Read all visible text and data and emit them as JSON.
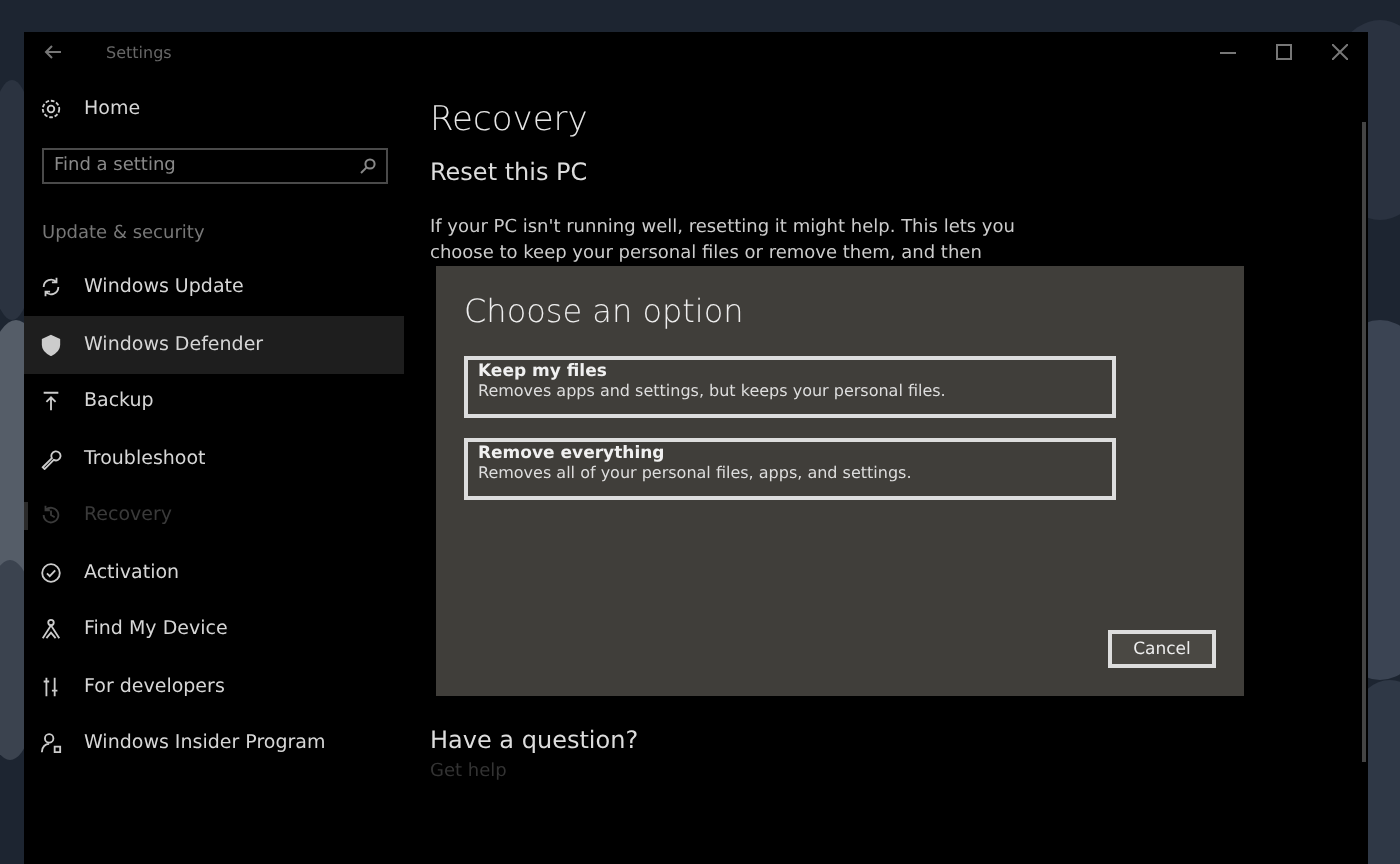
{
  "window": {
    "title": "Settings"
  },
  "sidebar": {
    "home": "Home",
    "search": {
      "placeholder": "Find a setting"
    },
    "section": "Update & security",
    "items": [
      {
        "label": "Windows Update",
        "selected": false,
        "hovered": false
      },
      {
        "label": "Windows Defender",
        "selected": false,
        "hovered": true
      },
      {
        "label": "Backup",
        "selected": false,
        "hovered": false
      },
      {
        "label": "Troubleshoot",
        "selected": false,
        "hovered": false
      },
      {
        "label": "Recovery",
        "selected": true,
        "hovered": false
      },
      {
        "label": "Activation",
        "selected": false,
        "hovered": false
      },
      {
        "label": "Find My Device",
        "selected": false,
        "hovered": false
      },
      {
        "label": "For developers",
        "selected": false,
        "hovered": false
      },
      {
        "label": "Windows Insider Program",
        "selected": false,
        "hovered": false
      }
    ]
  },
  "content": {
    "title": "Recovery",
    "section": "Reset this PC",
    "paragraph": "If your PC isn't running well, resetting it might help. This lets you choose to keep your personal files or remove them, and then",
    "question": "Have a question?",
    "help_link": "Get help"
  },
  "dialog": {
    "title": "Choose an option",
    "options": [
      {
        "title": "Keep my files",
        "description": "Removes apps and settings, but keeps your personal files."
      },
      {
        "title": "Remove everything",
        "description": "Removes all of your personal files, apps, and settings."
      }
    ],
    "cancel": "Cancel"
  }
}
